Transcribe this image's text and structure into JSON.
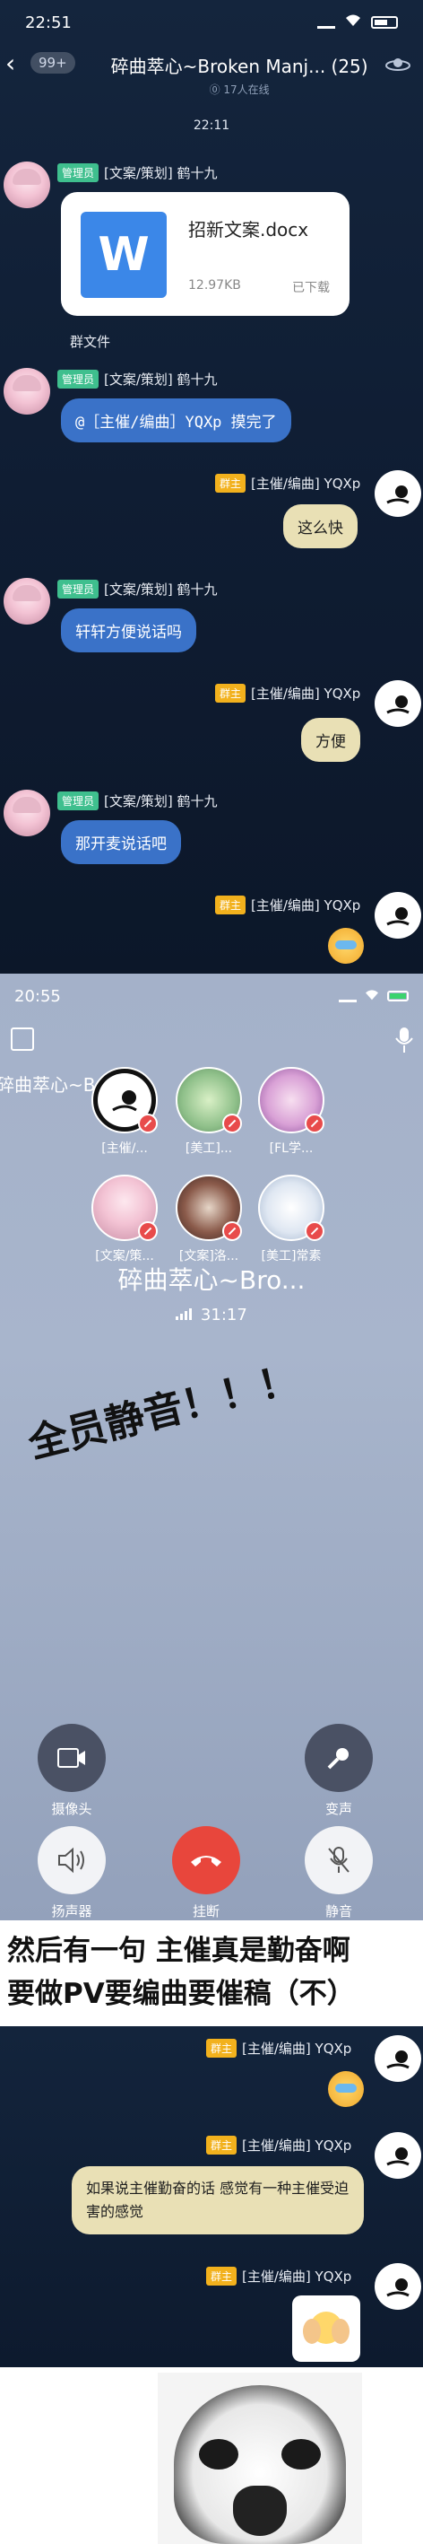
{
  "status_bar": {
    "time": "22:51"
  },
  "chat_header": {
    "unread": "99+",
    "title": "碎曲萃心~Broken Manj... (25)",
    "online": "⓪ 17人在线"
  },
  "chat1": {
    "timestamp": "22:11",
    "messages": [
      {
        "badge": "管理员",
        "name": "[文案/策划] 鹤十九",
        "type": "file",
        "file_name": "招新文案.docx",
        "file_size": "12.97KB",
        "file_status": "已下载",
        "file_icon": "W",
        "caption": "群文件"
      },
      {
        "badge": "管理员",
        "name": "[文案/策划] 鹤十九",
        "text": "@［主催/编曲］YQXp 摸完了"
      },
      {
        "badge": "群主",
        "name": "[主催/编曲] YQXp",
        "text": "这么快"
      },
      {
        "badge": "管理员",
        "name": "[文案/策划] 鹤十九",
        "text": "轩轩方便说话吗"
      },
      {
        "badge": "群主",
        "name": "[主催/编曲] YQXp",
        "text": "方便"
      },
      {
        "badge": "管理员",
        "name": "[文案/策划] 鹤十九",
        "text": "那开麦说话吧"
      },
      {
        "badge": "群主",
        "name": "[主催/编曲] YQXp"
      }
    ]
  },
  "call": {
    "time": "20:55",
    "title_top": "碎曲萃心~Broken",
    "members": [
      {
        "label": "[主催/..."
      },
      {
        "label": "[美工]..."
      },
      {
        "label": "[FL学..."
      },
      {
        "label": "[文案/策..."
      },
      {
        "label": "[文案]洛..."
      },
      {
        "label": "[美工]常素"
      }
    ],
    "group_name": "碎曲萃心~Bro...",
    "duration": "31:17",
    "overlay": "全员静音！！！",
    "controls": {
      "camera": "摄像头",
      "voice_change": "变声",
      "speaker": "扬声器",
      "hangup": "挂断",
      "mute": "静音"
    }
  },
  "caption": {
    "line1": "然后有一句 主催真是勤奋啊",
    "line2": "要做PV要编曲要催稿（不）"
  },
  "chat2": {
    "messages": [
      {
        "badge": "群主",
        "name": "[主催/编曲] YQXp"
      },
      {
        "badge": "群主",
        "name": "[主催/编曲] YQXp",
        "text": "如果说主催勤奋的话 感觉有一种主催受迫害的感觉"
      },
      {
        "badge": "群主",
        "name": "[主催/编曲] YQXp"
      }
    ]
  }
}
